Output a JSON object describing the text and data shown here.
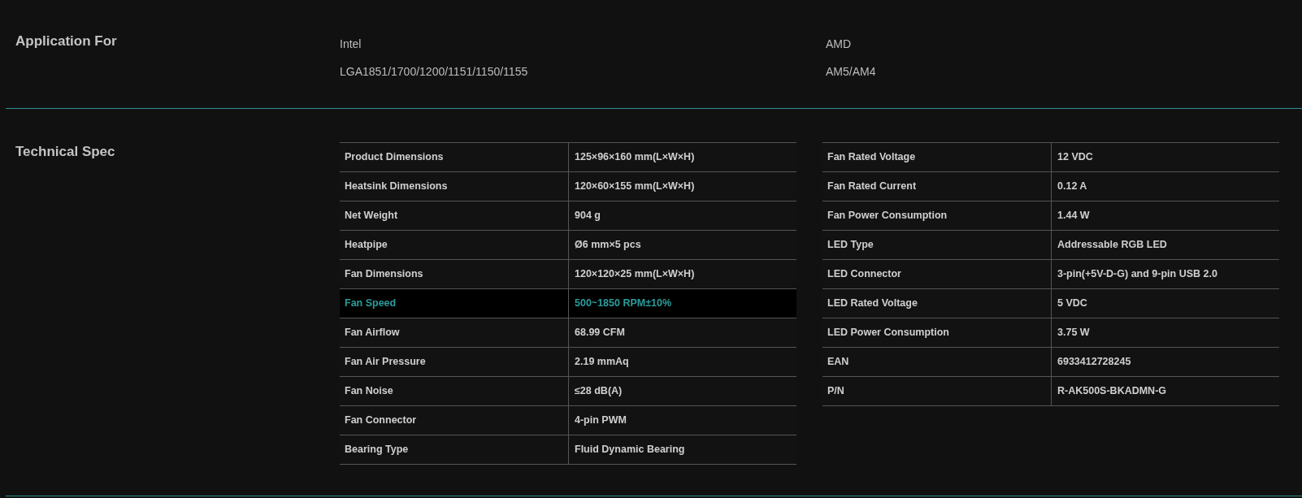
{
  "application": {
    "heading": "Application For",
    "platforms": [
      {
        "name": "Intel",
        "sockets": "LGA1851/1700/1200/1151/1150/1155"
      },
      {
        "name": "AMD",
        "sockets": "AM5/AM4"
      }
    ]
  },
  "spec": {
    "heading": "Technical Spec",
    "tables": [
      {
        "rows": [
          {
            "label": "Product Dimensions",
            "value": "125×96×160 mm(L×W×H)",
            "selected": false
          },
          {
            "label": "Heatsink Dimensions",
            "value": "120×60×155 mm(L×W×H)",
            "selected": false
          },
          {
            "label": "Net Weight",
            "value": "904 g",
            "selected": false
          },
          {
            "label": "Heatpipe",
            "value": "Ø6 mm×5 pcs",
            "selected": false
          },
          {
            "label": "Fan Dimensions",
            "value": "120×120×25 mm(L×W×H)",
            "selected": false
          },
          {
            "label": "Fan Speed",
            "value": "500~1850 RPM±10%",
            "selected": true
          },
          {
            "label": "Fan Airflow",
            "value": "68.99 CFM",
            "selected": false
          },
          {
            "label": "Fan Air Pressure",
            "value": "2.19 mmAq",
            "selected": false
          },
          {
            "label": "Fan Noise",
            "value": "≤28 dB(A)",
            "selected": false
          },
          {
            "label": "Fan Connector",
            "value": "4-pin PWM",
            "selected": false
          },
          {
            "label": "Bearing Type",
            "value": "Fluid Dynamic Bearing",
            "selected": false
          }
        ]
      },
      {
        "rows": [
          {
            "label": "Fan Rated Voltage",
            "value": "12 VDC",
            "selected": false
          },
          {
            "label": "Fan Rated Current",
            "value": "0.12 A",
            "selected": false
          },
          {
            "label": "Fan Power Consumption",
            "value": "1.44 W",
            "selected": false
          },
          {
            "label": "LED Type",
            "value": "Addressable RGB LED",
            "selected": false
          },
          {
            "label": "LED Connector",
            "value": "3-pin(+5V-D-G) and 9-pin USB 2.0",
            "selected": false
          },
          {
            "label": "LED Rated Voltage",
            "value": "5 VDC",
            "selected": false
          },
          {
            "label": "LED Power Consumption",
            "value": "3.75 W",
            "selected": false
          },
          {
            "label": "EAN",
            "value": "6933412728245",
            "selected": false
          },
          {
            "label": "P/N",
            "value": "R-AK500S-BKADMN-G",
            "selected": false
          }
        ]
      }
    ]
  }
}
